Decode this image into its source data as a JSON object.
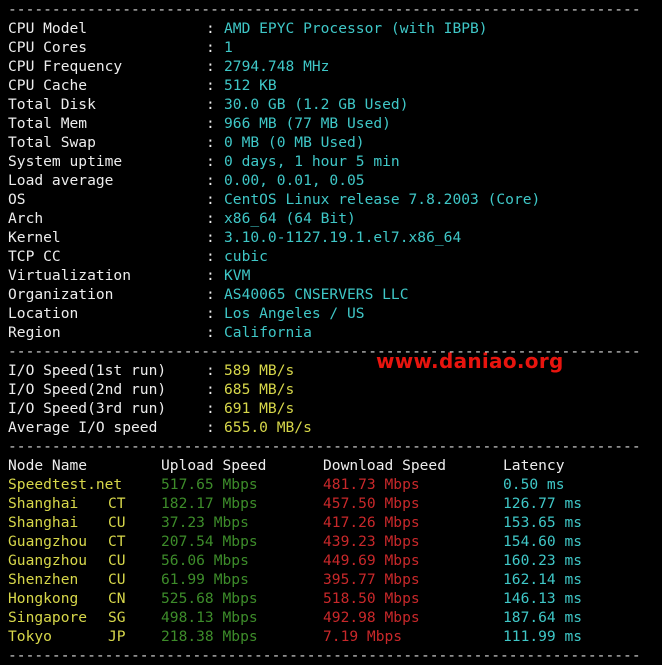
{
  "separator": "------------------------------------------------------------------------",
  "system_info": [
    {
      "label": "CPU Model",
      "value": "AMD EPYC Processor (with IBPB)"
    },
    {
      "label": "CPU Cores",
      "value": "1"
    },
    {
      "label": "CPU Frequency",
      "value": "2794.748 MHz"
    },
    {
      "label": "CPU Cache",
      "value": "512 KB"
    },
    {
      "label": "Total Disk",
      "value": "30.0 GB (1.2 GB Used)"
    },
    {
      "label": "Total Mem",
      "value": "966 MB (77 MB Used)"
    },
    {
      "label": "Total Swap",
      "value": "0 MB (0 MB Used)"
    },
    {
      "label": "System uptime",
      "value": "0 days, 1 hour 5 min"
    },
    {
      "label": "Load average",
      "value": "0.00, 0.01, 0.05"
    },
    {
      "label": "OS",
      "value": "CentOS Linux release 7.8.2003 (Core)"
    },
    {
      "label": "Arch",
      "value": "x86_64 (64 Bit)"
    },
    {
      "label": "Kernel",
      "value": "3.10.0-1127.19.1.el7.x86_64"
    },
    {
      "label": "TCP CC",
      "value": "cubic"
    },
    {
      "label": "Virtualization",
      "value": "KVM"
    },
    {
      "label": "Organization",
      "value": "AS40065 CNSERVERS LLC"
    },
    {
      "label": "Location",
      "value": "Los Angeles / US"
    },
    {
      "label": "Region",
      "value": "California"
    }
  ],
  "colon": ":",
  "io_speed": [
    {
      "label": "I/O Speed(1st run)",
      "value": "589 MB/s"
    },
    {
      "label": "I/O Speed(2nd run)",
      "value": "685 MB/s"
    },
    {
      "label": "I/O Speed(3rd run)",
      "value": "691 MB/s"
    },
    {
      "label": "Average I/O speed",
      "value": "655.0 MB/s"
    }
  ],
  "watermark": "www.daniao.org",
  "speed_table": {
    "headers": {
      "node": "Node Name",
      "upload": "Upload Speed",
      "download": "Download Speed",
      "latency": "Latency"
    },
    "rows": [
      {
        "node": "Speedtest.net",
        "code": "",
        "upload": "517.65 Mbps",
        "download": "481.73 Mbps",
        "latency": "0.50 ms"
      },
      {
        "node": "Shanghai",
        "code": "CT",
        "upload": "182.17 Mbps",
        "download": "457.50 Mbps",
        "latency": "126.77 ms"
      },
      {
        "node": "Shanghai",
        "code": "CU",
        "upload": "37.23 Mbps",
        "download": "417.26 Mbps",
        "latency": "153.65 ms"
      },
      {
        "node": "Guangzhou",
        "code": "CT",
        "upload": "207.54 Mbps",
        "download": "439.23 Mbps",
        "latency": "154.60 ms"
      },
      {
        "node": "Guangzhou",
        "code": "CU",
        "upload": "56.06 Mbps",
        "download": "449.69 Mbps",
        "latency": "160.23 ms"
      },
      {
        "node": "Shenzhen",
        "code": "CU",
        "upload": "61.99 Mbps",
        "download": "395.77 Mbps",
        "latency": "162.14 ms"
      },
      {
        "node": "Hongkong",
        "code": "CN",
        "upload": "525.68 Mbps",
        "download": "518.50 Mbps",
        "latency": "146.13 ms"
      },
      {
        "node": "Singapore",
        "code": "SG",
        "upload": "498.13 Mbps",
        "download": "492.98 Mbps",
        "latency": "187.64 ms"
      },
      {
        "node": "Tokyo",
        "code": "JP",
        "upload": "218.38 Mbps",
        "download": "7.19 Mbps",
        "latency": "111.99 ms"
      }
    ]
  },
  "colors": {
    "background": "#000000",
    "label": "#ededed",
    "cyan": "#3fc7c7",
    "yellow": "#d7d74a",
    "green": "#3d8c2a",
    "red": "#c8282a",
    "watermark": "#e8140e"
  }
}
